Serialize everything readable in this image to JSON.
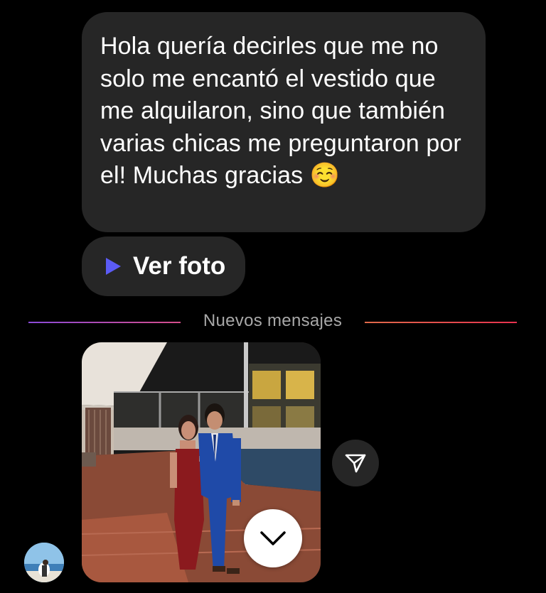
{
  "messages": {
    "text_message": "Hola quería decirles que me no solo me encantó el vestido que me alquilaron, sino que también varias chicas me preguntaron por el! Muchas gracias ☺️",
    "photo_message_label": "Ver foto"
  },
  "divider": {
    "label": "Nuevos mensajes"
  },
  "icons": {
    "play": "play-icon",
    "share": "paper-plane-icon",
    "scroll": "chevron-down-icon"
  },
  "colors": {
    "background": "#000000",
    "bubble": "#262626",
    "play_accent": "#5b5bf5",
    "divider_left": "#8a49d9",
    "divider_right": "#e8324f",
    "divider_text": "#a8a8a8"
  }
}
